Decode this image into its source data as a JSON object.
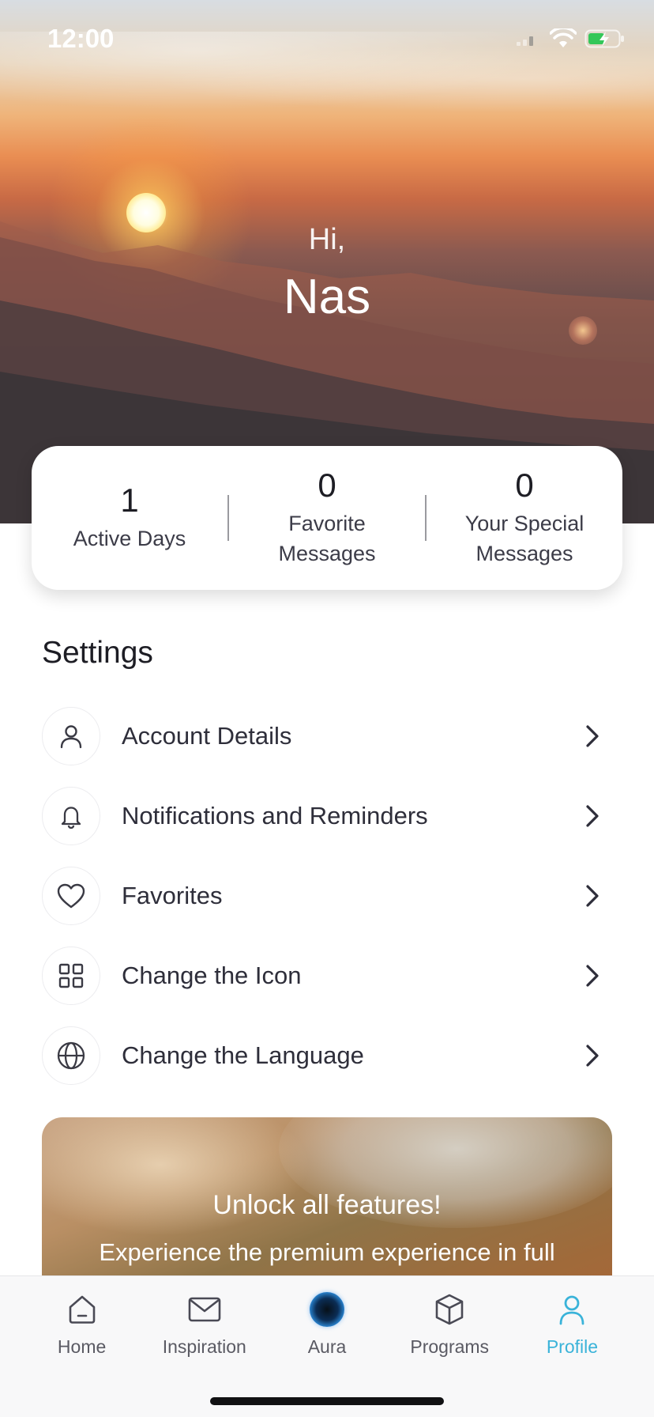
{
  "status_bar": {
    "time": "12:00",
    "icons": [
      "signal-icon",
      "wifi-icon",
      "battery-charging-icon"
    ]
  },
  "greeting": {
    "hi": "Hi,",
    "name": "Nas"
  },
  "stats": [
    {
      "value": "1",
      "label": "Active Days"
    },
    {
      "value": "0",
      "label": "Favorite Messages"
    },
    {
      "value": "0",
      "label": "Your Special Messages"
    }
  ],
  "settings": {
    "title": "Settings",
    "items": [
      {
        "label": "Account Details",
        "icon": "user-icon"
      },
      {
        "label": "Notifications and Reminders",
        "icon": "bell-icon"
      },
      {
        "label": "Favorites",
        "icon": "heart-icon"
      },
      {
        "label": "Change the Icon",
        "icon": "grid-icon"
      },
      {
        "label": "Change the Language",
        "icon": "globe-icon"
      }
    ]
  },
  "promo": {
    "title": "Unlock all features!",
    "subtitle": "Experience the premium experience in full"
  },
  "tab_bar": {
    "active": "Profile",
    "accent_color": "#3ab3d9",
    "tabs": [
      {
        "label": "Home",
        "icon": "home-icon"
      },
      {
        "label": "Inspiration",
        "icon": "envelope-icon"
      },
      {
        "label": "Aura",
        "icon": "aura-orb-icon"
      },
      {
        "label": "Programs",
        "icon": "cube-icon"
      },
      {
        "label": "Profile",
        "icon": "user-icon"
      }
    ]
  }
}
